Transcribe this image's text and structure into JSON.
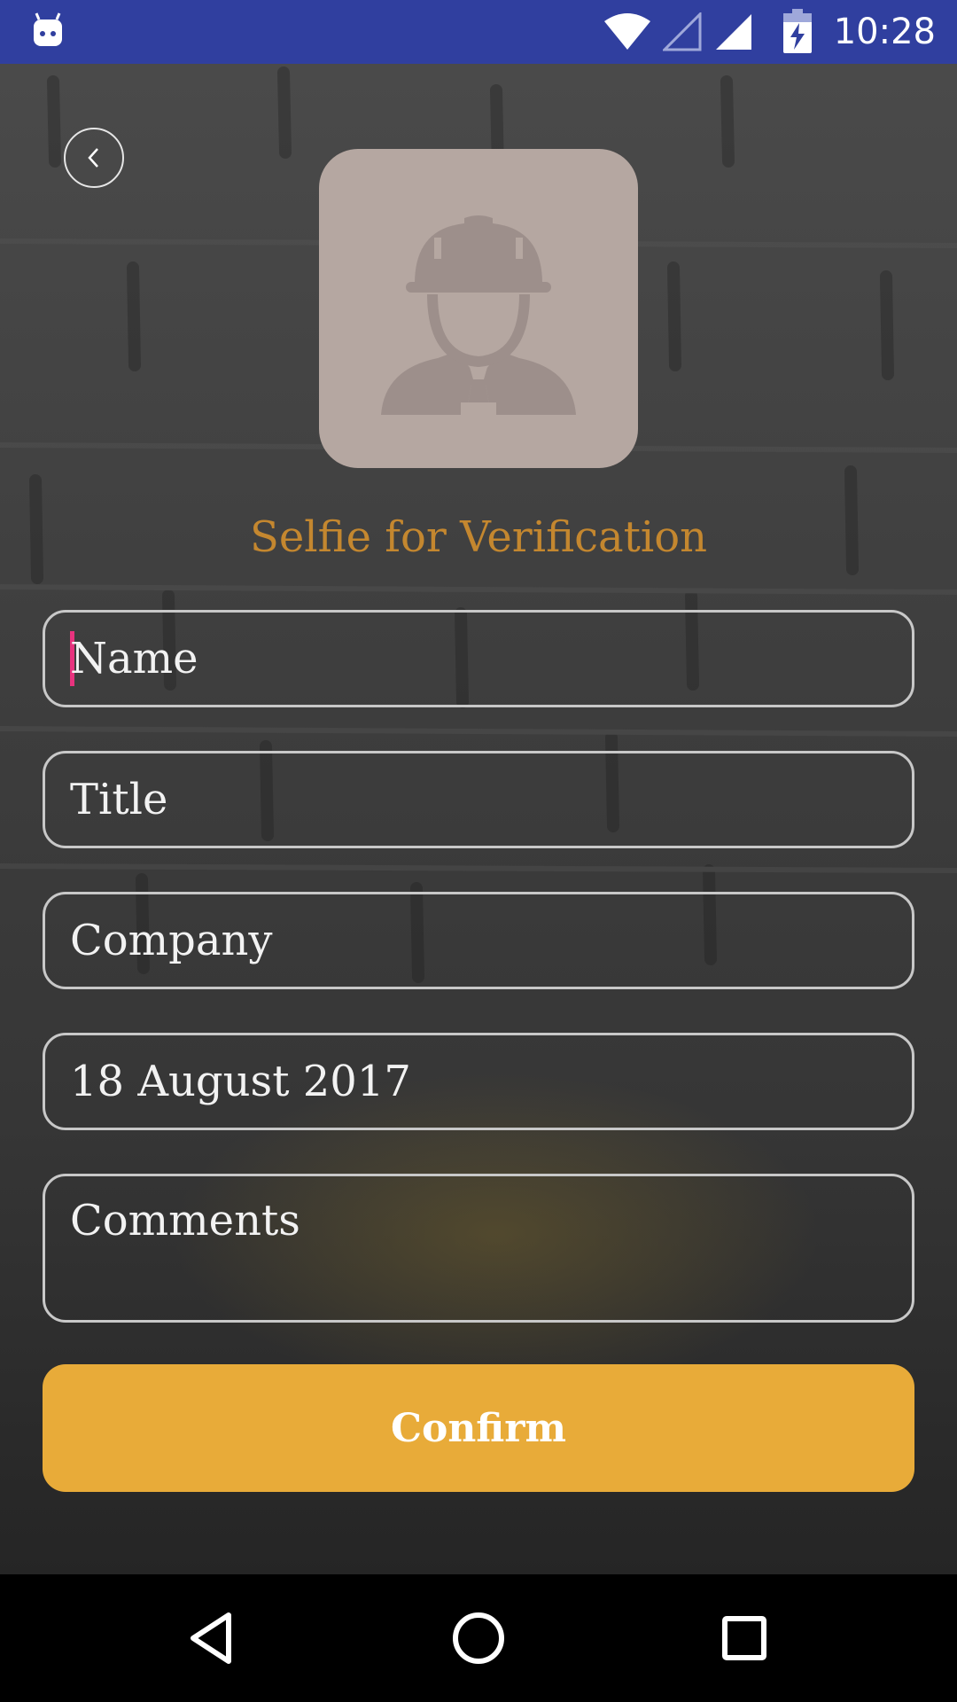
{
  "status_bar": {
    "time": "10:28",
    "icons": [
      "android-debug-icon",
      "wifi-icon",
      "signal-empty-icon",
      "signal-icon",
      "battery-charging-icon"
    ]
  },
  "header": {
    "back_icon": "chevron-left-icon"
  },
  "avatar": {
    "icon": "worker-helmet-icon"
  },
  "heading": "Selfie for Verification",
  "form": {
    "name_placeholder": "Name",
    "title_placeholder": "Title",
    "company_placeholder": "Company",
    "date_value": "18 August 2017",
    "comments_placeholder": "Comments",
    "confirm_label": "Confirm"
  },
  "colors": {
    "status_bar": "#303f9f",
    "heading": "#c4872f",
    "confirm": "#e8ab39",
    "avatar_bg": "#b5a7a1",
    "caret": "#e8337e"
  },
  "nav_bar": {
    "icons": [
      "back-triangle-icon",
      "home-circle-icon",
      "recents-square-icon"
    ]
  }
}
